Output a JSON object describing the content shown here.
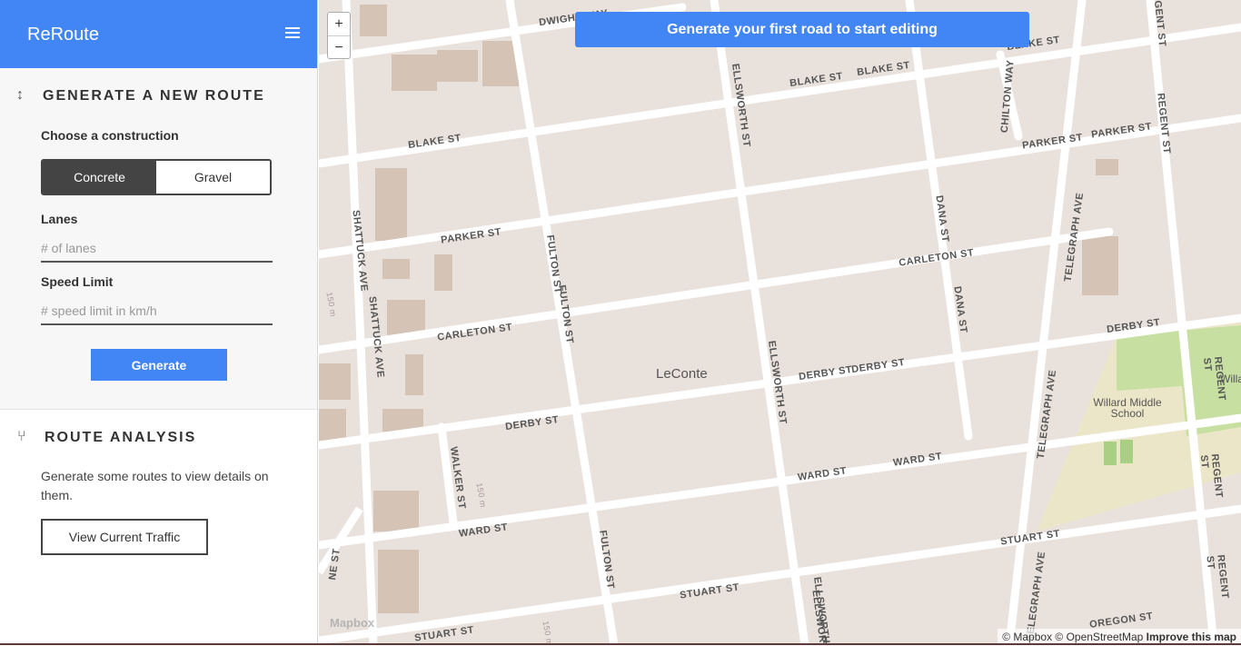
{
  "app": {
    "title": "ReRoute"
  },
  "generate": {
    "heading": "GENERATE A NEW ROUTE",
    "construction_label": "Choose a construction",
    "construction_options": [
      "Concrete",
      "Gravel"
    ],
    "construction_selected": "Concrete",
    "lanes_label": "Lanes",
    "lanes_placeholder": "# of lanes",
    "speed_label": "Speed Limit",
    "speed_placeholder": "# speed limit in km/h",
    "button": "Generate"
  },
  "analysis": {
    "heading": "ROUTE ANALYSIS",
    "text": "Generate some routes to view details on them.",
    "button": "View Current Traffic"
  },
  "map": {
    "banner": "Generate your first road to start editing",
    "zoom_in": "+",
    "zoom_out": "−",
    "center_label": "LeConte",
    "poi": [
      "Willard Middle",
      "School",
      "Willa"
    ],
    "street_labels": [
      "DWIGHT WAY",
      "BLAKE ST",
      "BLAKE ST",
      "BLAKE ST",
      "BLAKE ST",
      "PARKER ST",
      "PARKER ST",
      "PARKER ST",
      "CARLETON ST",
      "CARLETON ST",
      "DERBY ST",
      "DERBY ST",
      "DERBY ST",
      "DERBY ST",
      "WARD ST",
      "WARD ST",
      "WARD ST",
      "STUART ST",
      "STUART ST",
      "STUART ST",
      "OREGON ST",
      "SHATTUCK AVE",
      "SHATTUCK AVE",
      "FULTON ST",
      "FULTON ST",
      "FULTON ST",
      "ELLSWORTH ST",
      "ELLSWORTH ST",
      "ELLSWORTH ST",
      "ELLSWORT",
      "DANA ST",
      "DANA ST",
      "TELEGRAPH AVE",
      "TELEGRAPH AVE",
      "TELEGRAPH AVE",
      "CHILTON WAY",
      "REGENT ST",
      "REGENT ST",
      "REGENT ST",
      "REGENT ST",
      "GENT ST",
      "WALKER ST",
      "NE ST",
      "150 m",
      "150 m",
      "150 m"
    ],
    "logo": "Mapbox",
    "attribution": "© Mapbox © OpenStreetMap",
    "improve": "Improve this map"
  },
  "colors": {
    "accent": "#4285f4",
    "map_bg": "#e9e1dc",
    "park": "#c7dfa0"
  }
}
